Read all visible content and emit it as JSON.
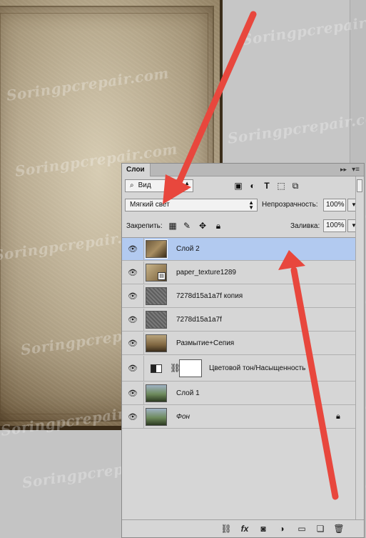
{
  "watermark_text": "Soringpcrepair.com",
  "panel": {
    "tab_title": "Слои",
    "collapse_icon": "double-chevron-right-icon",
    "menu_icon": "panel-menu-icon"
  },
  "filter": {
    "kind_label": "Вид",
    "icons": [
      "image-filter-icon",
      "adjustment-filter-icon",
      "type-filter-icon",
      "shape-filter-icon",
      "smart-object-filter-icon"
    ]
  },
  "blend": {
    "mode": "Мягкий свет",
    "opacity_label": "Непрозрачность:",
    "opacity_value": "100%"
  },
  "lock": {
    "label": "Закрепить:",
    "fill_label": "Заливка:",
    "fill_value": "100%"
  },
  "layers": [
    {
      "name": "Слой 2",
      "selected": true,
      "italic": false
    },
    {
      "name": "paper_texture1289",
      "selected": false,
      "italic": false
    },
    {
      "name": "7278d15a1a7f копия",
      "selected": false,
      "italic": false
    },
    {
      "name": "7278d15a1a7f",
      "selected": false,
      "italic": false
    },
    {
      "name": "Размытие+Сепия",
      "selected": false,
      "italic": false
    },
    {
      "name": "Цветовой тон/Насыщенность",
      "selected": false,
      "italic": false
    },
    {
      "name": "Слой 1",
      "selected": false,
      "italic": false
    },
    {
      "name": "Фон",
      "selected": false,
      "italic": true,
      "locked": true
    }
  ],
  "footer": {
    "icons": [
      "link-layers-icon",
      "fx-icon",
      "add-mask-icon",
      "adjustment-layer-icon",
      "new-group-icon",
      "new-layer-icon",
      "delete-layer-icon"
    ],
    "fx_text": "fx"
  },
  "colors": {
    "selected_row": "#b2caf0",
    "panel_bg": "#d6d6d6",
    "arrow": "#e8473d"
  }
}
